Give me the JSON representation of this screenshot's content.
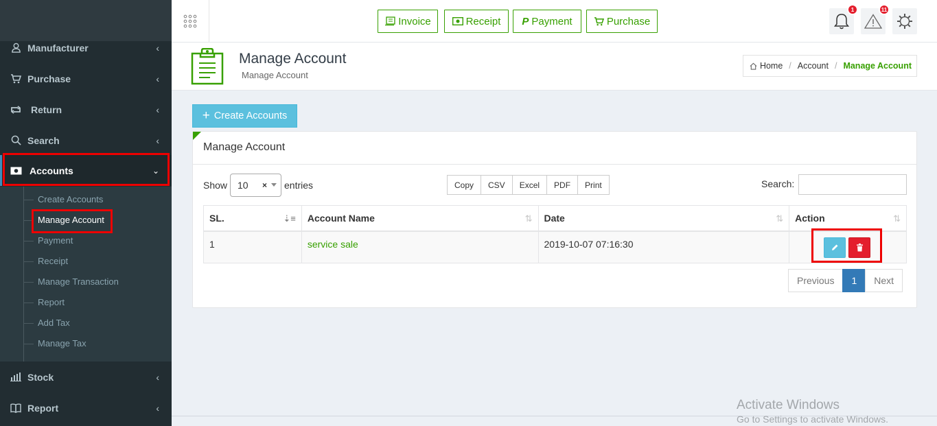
{
  "sidebar": {
    "items": [
      {
        "label": "Manufacturer",
        "icon": "user-tie-icon"
      },
      {
        "label": "Purchase",
        "icon": "cart-icon"
      },
      {
        "label": "Return",
        "icon": "retweet-icon"
      },
      {
        "label": "Search",
        "icon": "search-icon"
      },
      {
        "label": "Accounts",
        "icon": "money-icon"
      },
      {
        "label": "Stock",
        "icon": "bar-chart-icon"
      },
      {
        "label": "Report",
        "icon": "book-icon"
      }
    ],
    "accounts_submenu": [
      "Create Accounts",
      "Manage Account",
      "Payment",
      "Receipt",
      "Manage Transaction",
      "Report",
      "Add Tax",
      "Manage Tax"
    ]
  },
  "topbar": {
    "buttons": [
      "Invoice",
      "Receipt",
      "Payment",
      "Purchase"
    ],
    "notification_count": "1",
    "alert_count": "11"
  },
  "header": {
    "title": "Manage Account",
    "subtitle": "Manage Account",
    "breadcrumb": [
      "Home",
      "Account",
      "Manage Account"
    ]
  },
  "main": {
    "create_button": "Create Accounts",
    "panel_title": "Manage Account",
    "show_label": "Show",
    "page_length": "10",
    "entries_label": "entries",
    "export_buttons": [
      "Copy",
      "CSV",
      "Excel",
      "PDF",
      "Print"
    ],
    "search_label": "Search:",
    "table": {
      "columns": [
        "SL.",
        "Account Name",
        "Date",
        "Action"
      ],
      "rows": [
        {
          "sl": "1",
          "account_name": "service sale",
          "date": "2019-10-07 07:16:30"
        }
      ]
    },
    "pagination": {
      "previous": "Previous",
      "current": "1",
      "next": "Next"
    }
  },
  "watermark": {
    "line1": "Activate Windows",
    "line2": "Go to Settings to activate Windows."
  },
  "colors": {
    "sidebar_bg": "#222d32",
    "accent_green": "#37a000",
    "info_blue": "#5bc0de",
    "danger_red": "#e41e2d",
    "highlight_red": "#ee0000",
    "pager_blue": "#337ab7"
  }
}
